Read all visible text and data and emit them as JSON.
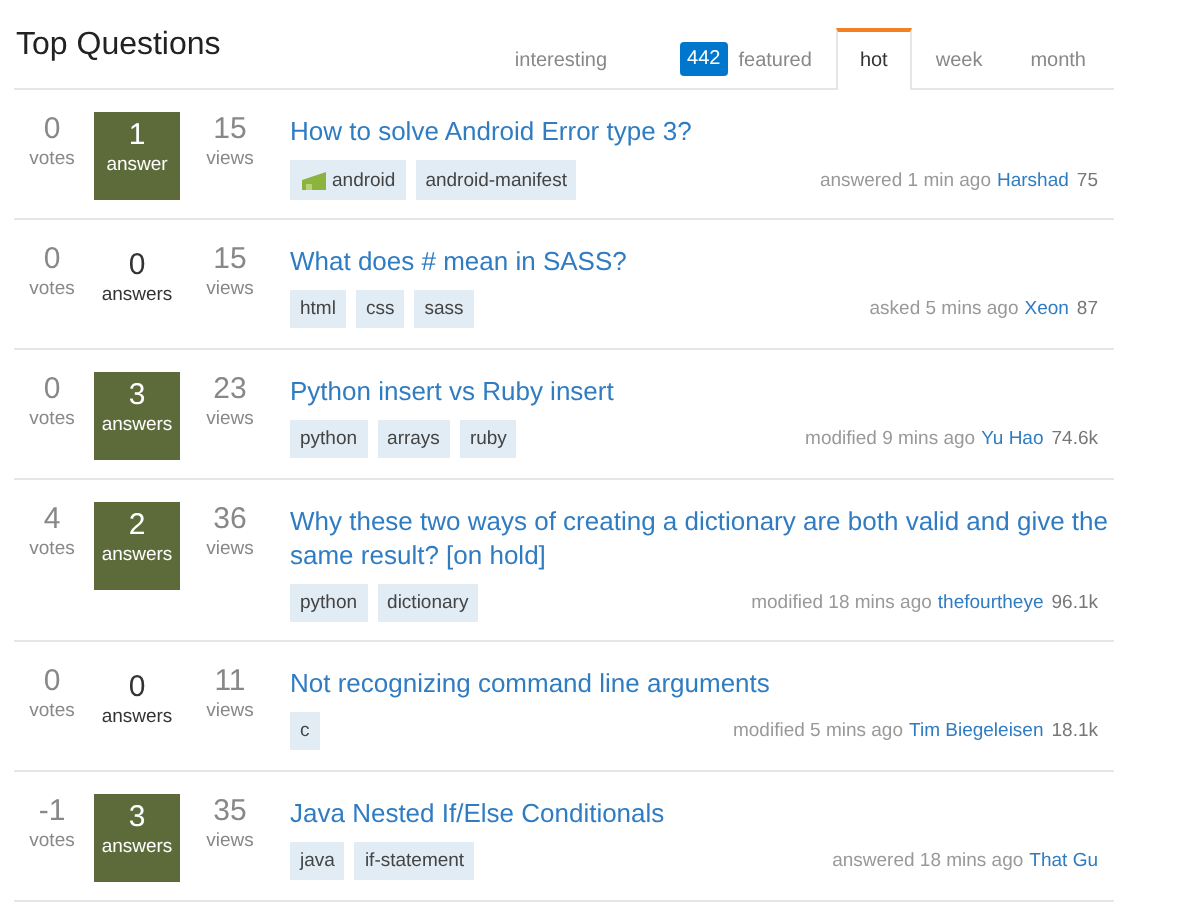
{
  "header": {
    "title": "Top Questions"
  },
  "tabs": [
    {
      "label": "interesting",
      "selected": false
    },
    {
      "label": "featured",
      "selected": false,
      "badge": "442"
    },
    {
      "label": "hot",
      "selected": true
    },
    {
      "label": "week",
      "selected": false
    },
    {
      "label": "month",
      "selected": false
    }
  ],
  "questions": [
    {
      "votes": "0",
      "votes_label": "votes",
      "answers": "1",
      "answers_label": "answer",
      "accepted": true,
      "views": "15",
      "views_label": "views",
      "title": "How to solve Android Error type 3?",
      "tags": [
        {
          "label": "android",
          "kind": "icon"
        },
        {
          "label": "android-manifest",
          "kind": "plain"
        }
      ],
      "action": "answered 1 min ago",
      "user": "Harshad",
      "rep": "75"
    },
    {
      "votes": "0",
      "votes_label": "votes",
      "answers": "0",
      "answers_label": "answers",
      "accepted": false,
      "views": "15",
      "views_label": "views",
      "title": "What does # mean in SASS?",
      "tags": [
        {
          "label": "html",
          "kind": "plain"
        },
        {
          "label": "css",
          "kind": "plain"
        },
        {
          "label": "sass",
          "kind": "plain"
        }
      ],
      "action": "asked 5 mins ago",
      "user": "Xeon",
      "rep": "87"
    },
    {
      "votes": "0",
      "votes_label": "votes",
      "answers": "3",
      "answers_label": "answers",
      "accepted": true,
      "views": "23",
      "views_label": "views",
      "title": "Python insert vs Ruby insert",
      "tags": [
        {
          "label": "python",
          "kind": "plain"
        },
        {
          "label": "arrays",
          "kind": "plain"
        },
        {
          "label": "ruby",
          "kind": "plain"
        }
      ],
      "action": "modified 9 mins ago",
      "user": "Yu Hao",
      "rep": "74.6k"
    },
    {
      "votes": "4",
      "votes_label": "votes",
      "answers": "2",
      "answers_label": "answers",
      "accepted": true,
      "views": "36",
      "views_label": "views",
      "title": "Why these two ways of creating a dictionary are both valid and give the same result? [on hold]",
      "tags": [
        {
          "label": "python",
          "kind": "plain"
        },
        {
          "label": "dictionary",
          "kind": "plain"
        }
      ],
      "action": "modified 18 mins ago",
      "user": "thefourtheye",
      "rep": "96.1k"
    },
    {
      "votes": "0",
      "votes_label": "votes",
      "answers": "0",
      "answers_label": "answers",
      "accepted": false,
      "views": "11",
      "views_label": "views",
      "title": "Not recognizing command line arguments",
      "tags": [
        {
          "label": "c",
          "kind": "plain"
        }
      ],
      "action": "modified 5 mins ago",
      "user": "Tim Biegeleisen",
      "rep": "18.1k"
    },
    {
      "votes": "-1",
      "votes_label": "votes",
      "answers": "3",
      "answers_label": "answers",
      "accepted": true,
      "views": "35",
      "views_label": "views",
      "title": "Java Nested If/Else Conditionals",
      "tags": [
        {
          "label": "java",
          "kind": "plain"
        },
        {
          "label": "if-statement",
          "kind": "plain"
        }
      ],
      "action": "answered 18 mins ago",
      "user": "That Gu"
    }
  ]
}
